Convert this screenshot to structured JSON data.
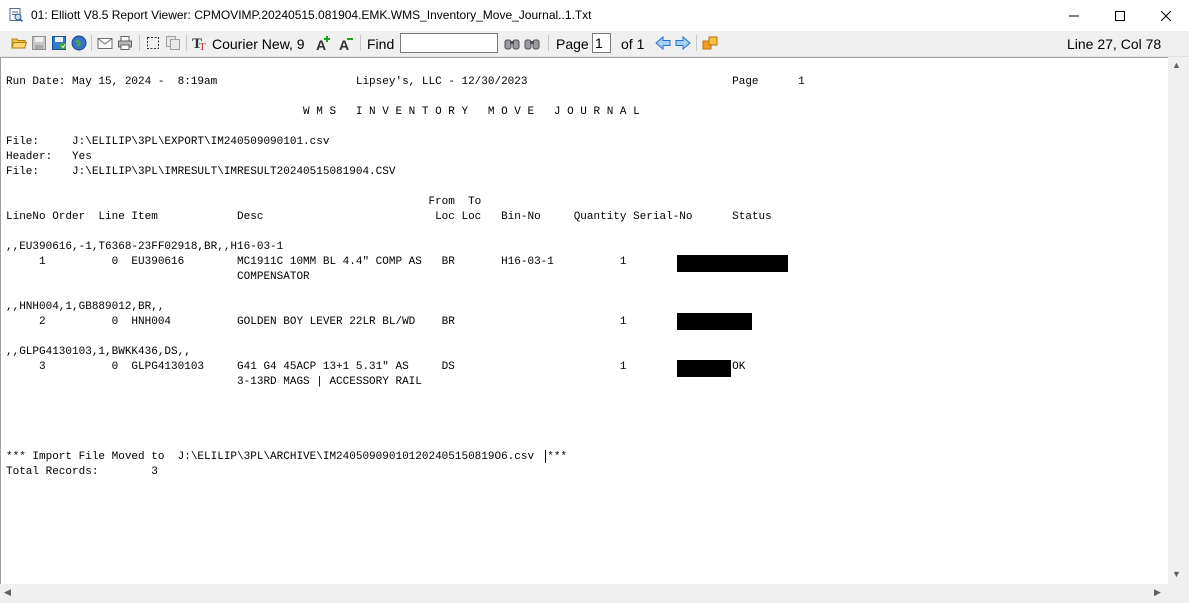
{
  "window": {
    "title": "01: Elliott V8.5 Report Viewer: CPMOVIMP.20240515.081904.EMK.WMS_Inventory_Move_Journal..1.Txt"
  },
  "toolbar": {
    "font_label": "Courier New, 9",
    "find_label": "Find",
    "find_value": "",
    "page_label": "Page",
    "page_value": "1",
    "of_label": "of 1",
    "position": "Line 27, Col 78"
  },
  "report": {
    "lines": [
      "Run Date: May 15, 2024 -  8:19am                     Lipsey's, LLC - 12/30/2023                               Page      1",
      "",
      "                                             W M S   I N V E N T O R Y   M O V E   J O U R N A L",
      "",
      "File:     J:\\ELILIP\\3PL\\EXPORT\\IM240509090101.csv",
      "Header:   Yes",
      "File:     J:\\ELILIP\\3PL\\IMRESULT\\IMRESULT20240515081904.CSV",
      "",
      "                                                                From  To",
      "LineNo Order  Line Item            Desc                          Loc Loc   Bin-No     Quantity Serial-No      Status",
      "",
      ",,EU390616,-1,T6368-23FF02918,BR,,H16-03-1",
      "     1          0  EU390616        MC1911C 10MM BL 4.4\" COMP AS   BR       H16-03-1          1              OK",
      "                                   COMPENSATOR",
      "",
      ",,HNH004,1,GB889012,BR,,",
      "     2          0  HNH004          GOLDEN BOY LEVER 22LR BL/WD    BR                         1                OK",
      "",
      ",,GLPG4130103,1,BWKK436,DS,,",
      "     3          0  GLPG4130103     G41 G4 45ACP 13+1 5.31\" AS     DS                         1                OK",
      "                                   3-13RD MAGS | ACCESSORY RAIL",
      "",
      "",
      "",
      "",
      "*** Import File Moved to  J:\\ELILIP\\3PL\\ARCHIVE\\IM240509090101202405150819O6.csv  ***",
      "Total Records:        3"
    ]
  }
}
